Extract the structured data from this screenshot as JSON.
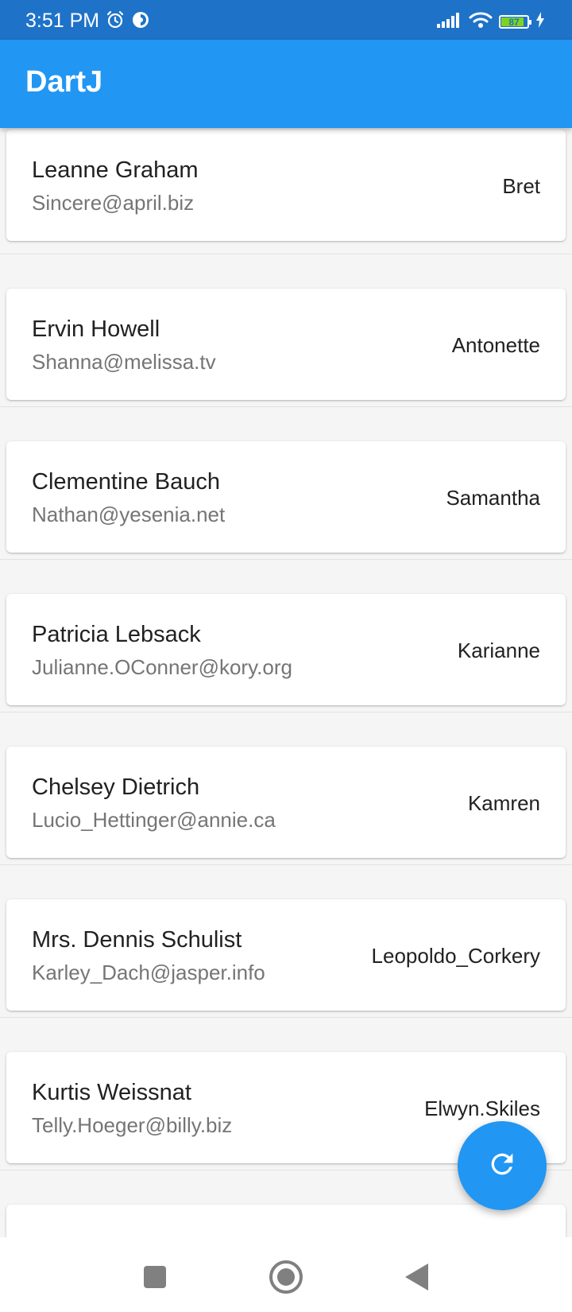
{
  "status_bar": {
    "time": "3:51 PM",
    "battery_level": "87",
    "battery_fill": 0.87,
    "icons": [
      "alarm-icon",
      "data-saver-icon",
      "signal-icon",
      "wifi-icon",
      "battery-icon",
      "charging-icon"
    ]
  },
  "app_bar": {
    "title": "DartJ"
  },
  "users": [
    {
      "name": "Leanne Graham",
      "email": "Sincere@april.biz",
      "username": "Bret"
    },
    {
      "name": "Ervin Howell",
      "email": "Shanna@melissa.tv",
      "username": "Antonette"
    },
    {
      "name": "Clementine Bauch",
      "email": "Nathan@yesenia.net",
      "username": "Samantha"
    },
    {
      "name": "Patricia Lebsack",
      "email": "Julianne.OConner@kory.org",
      "username": "Karianne"
    },
    {
      "name": "Chelsey Dietrich",
      "email": "Lucio_Hettinger@annie.ca",
      "username": "Kamren"
    },
    {
      "name": "Mrs. Dennis Schulist",
      "email": "Karley_Dach@jasper.info",
      "username": "Leopoldo_Corkery"
    },
    {
      "name": "Kurtis Weissnat",
      "email": "Telly.Hoeger@billy.biz",
      "username": "Elwyn.Skiles"
    }
  ],
  "fab": {
    "icon": "refresh-icon"
  },
  "nav_bar": {
    "icons": [
      "recents-icon",
      "home-icon",
      "back-icon"
    ]
  },
  "colors": {
    "primary": "#2196f3",
    "status_bar": "#1e73c8",
    "background": "#f5f5f5"
  }
}
